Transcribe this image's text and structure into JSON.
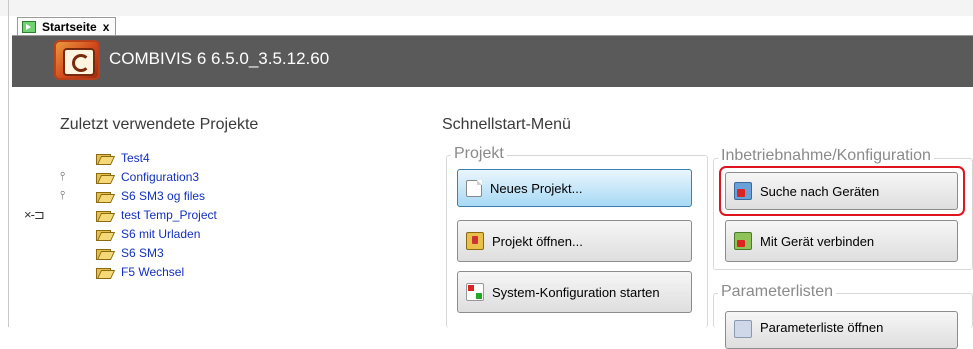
{
  "tab": {
    "label": "Startseite",
    "close": "x"
  },
  "header": {
    "title": "COMBIVIS 6 6.5.0_3.5.12.60"
  },
  "recent": {
    "title": "Zuletzt verwendete Projekte",
    "items": [
      {
        "label": "Test4"
      },
      {
        "label": "Configuration3"
      },
      {
        "label": "S6 SM3 og files"
      },
      {
        "label": "test Temp_Project"
      },
      {
        "label": "S6 mit Urladen"
      },
      {
        "label": "S6 SM3"
      },
      {
        "label": "F5 Wechsel"
      }
    ],
    "unpin_glyph": "×-⊐",
    "pin_glyph": "⫯"
  },
  "quickstart": {
    "title": "Schnellstart-Menü",
    "project_group": {
      "label": "Projekt",
      "buttons": [
        {
          "label": "Neues Projekt...",
          "icon": "new-document-icon"
        },
        {
          "label": "Projekt öffnen...",
          "icon": "open-folder-icon"
        },
        {
          "label": "System-Konfiguration starten",
          "icon": "system-config-icon"
        }
      ]
    },
    "commissioning_group": {
      "label": "Inbetriebnahme/Konfiguration",
      "buttons": [
        {
          "label": "Suche nach Geräten",
          "icon": "device-search-icon"
        },
        {
          "label": "Mit Gerät verbinden",
          "icon": "device-connect-icon"
        }
      ]
    },
    "parameter_group": {
      "label": "Parameterlisten",
      "buttons": [
        {
          "label": "Parameterliste öffnen",
          "icon": "parameter-list-icon"
        }
      ]
    }
  },
  "colors": {
    "header_bg": "#5a5a5a",
    "link": "#1030c0",
    "highlight": "#e0141e",
    "active_button": "#a7d9f5"
  }
}
